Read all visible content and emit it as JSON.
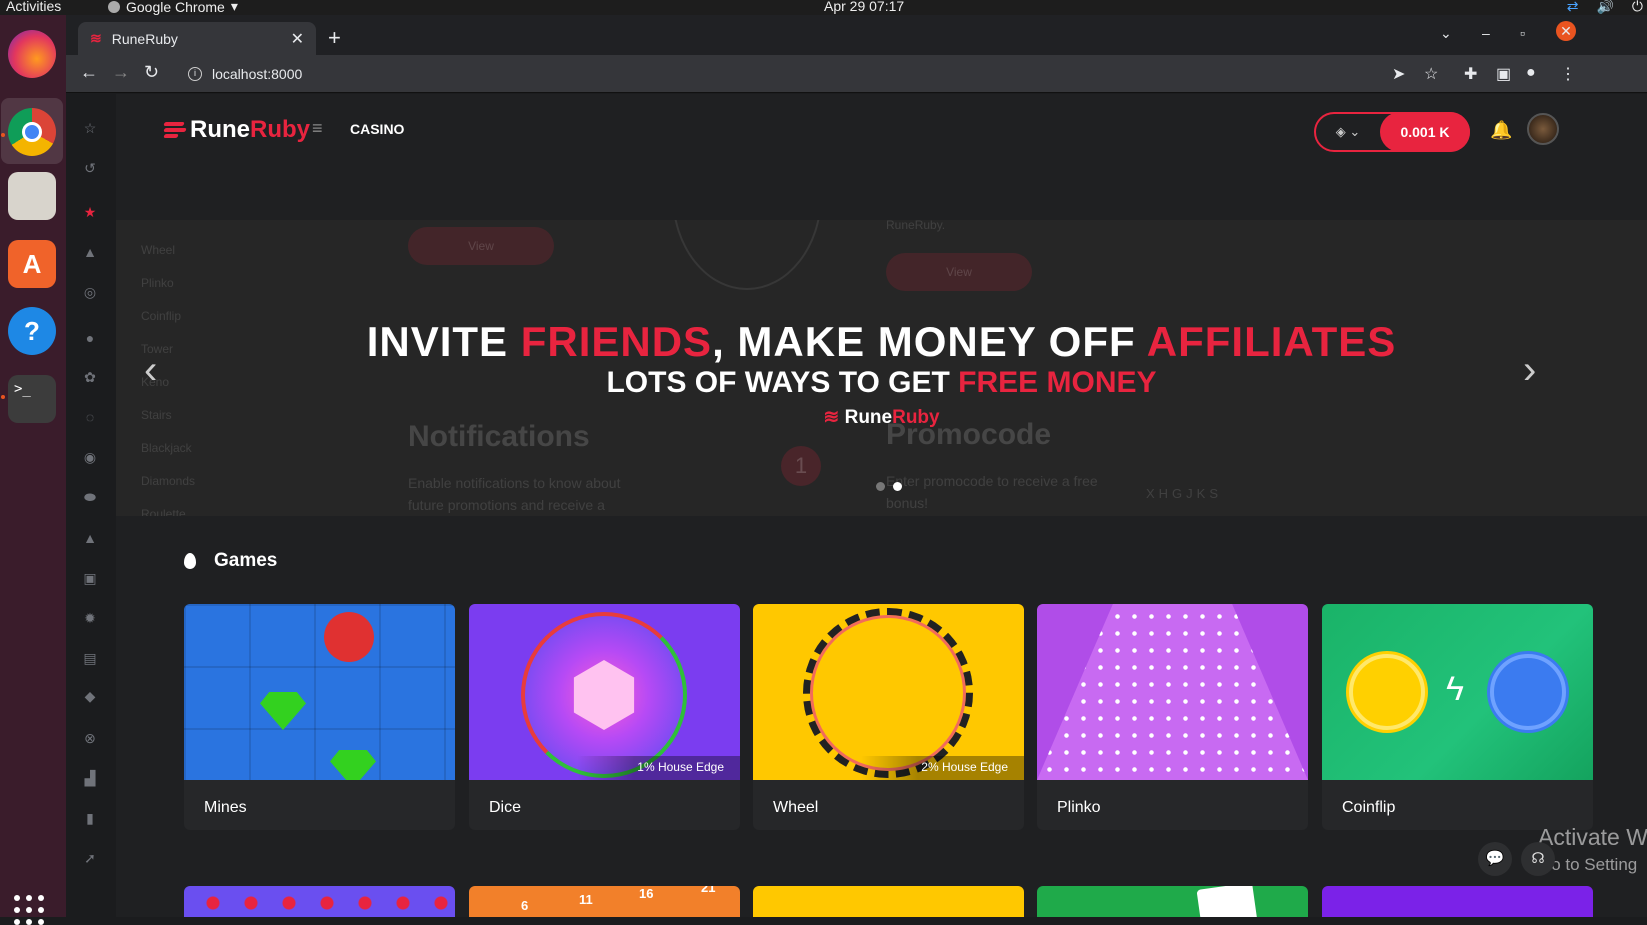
{
  "os": {
    "activities": "Activities",
    "app_name": "Google Chrome",
    "clock": "Apr 29  07:17"
  },
  "browser": {
    "tab_title": "RuneRuby",
    "url": "localhost:8000"
  },
  "site": {
    "logo_part1": "Rune",
    "logo_part2": "Ruby",
    "nav_casino": "CASINO",
    "balance": "0.001 K",
    "side_menu_ghost": [
      "Wheel",
      "Plinko",
      "Coinflip",
      "Tower",
      "Keno",
      "Stairs",
      "Blackjack",
      "Diamonds",
      "Roulette"
    ]
  },
  "banner": {
    "line1_a": "INVITE ",
    "line1_b": "FRIENDS",
    "line1_c": ", MAKE MONEY OFF ",
    "line1_d": "AFFILIATES",
    "line2_a": "LOTS OF WAYS TO GET ",
    "line2_b": "FREE MONEY",
    "logo_part1": "Rune",
    "logo_part2": "Ruby",
    "ghost_view_label": "View",
    "ghost_notifications_title": "Notifications",
    "ghost_notifications_text": "Enable notifications to know about future promotions and receive a",
    "ghost_promocode_title": "Promocode",
    "ghost_promocode_text": "Enter promocode to receive a free bonus!",
    "ghost_runeruby": "RuneRuby.",
    "ghost_code": "XHGJKS",
    "ghost_badge": "1",
    "slide_count": 2,
    "active_slide": 2
  },
  "games": {
    "heading": "Games",
    "cards": [
      {
        "title": "Mines",
        "edge": ""
      },
      {
        "title": "Dice",
        "edge": "1% House Edge"
      },
      {
        "title": "Wheel",
        "edge": "2% House Edge"
      },
      {
        "title": "Plinko",
        "edge": ""
      },
      {
        "title": "Coinflip",
        "edge": ""
      }
    ],
    "row2_numbers": [
      "6",
      "11",
      "16",
      "21"
    ]
  },
  "overlay": {
    "activate_line1": "Activate W",
    "activate_line2": "Go to Setting"
  },
  "colors": {
    "accent": "#e8243f",
    "bg": "#1f2022"
  }
}
